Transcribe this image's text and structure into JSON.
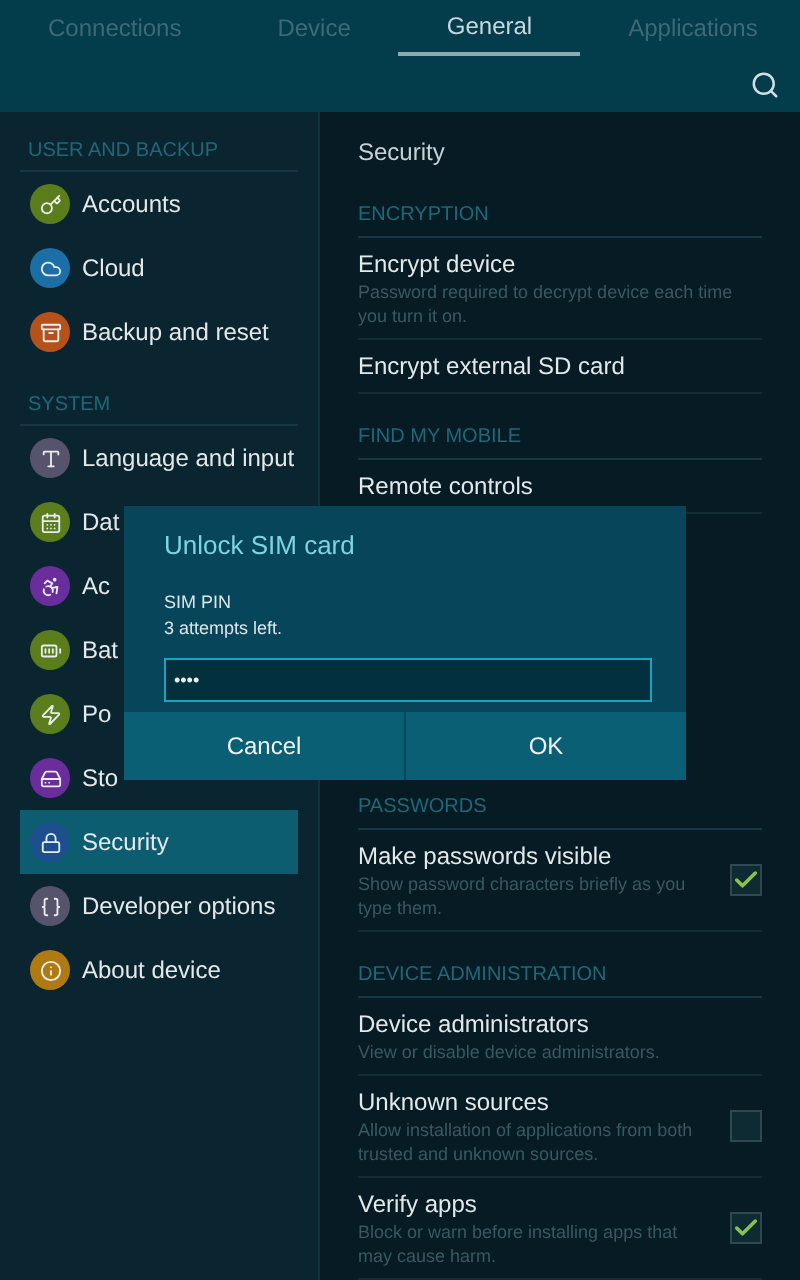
{
  "tabs": [
    {
      "label": "Connections",
      "selected": false
    },
    {
      "label": "Device",
      "selected": false
    },
    {
      "label": "General",
      "selected": true
    },
    {
      "label": "Applications",
      "selected": false
    }
  ],
  "sidebar": {
    "sections": [
      {
        "header": "USER AND BACKUP",
        "items": [
          {
            "label": "Accounts",
            "color": "#5b7d1c",
            "selected": false
          },
          {
            "label": "Cloud",
            "color": "#1c6ea6",
            "selected": false
          },
          {
            "label": "Backup and reset",
            "color": "#b5521c",
            "selected": false
          }
        ]
      },
      {
        "header": "SYSTEM",
        "items": [
          {
            "label": "Language and input",
            "color": "#57536d",
            "selected": false
          },
          {
            "label": "Dat",
            "color": "#5b7d1c",
            "selected": false
          },
          {
            "label": "Ac",
            "color": "#6a2d9c",
            "selected": false
          },
          {
            "label": "Bat",
            "color": "#5b7d1c",
            "selected": false
          },
          {
            "label": "Po",
            "color": "#5b7d1c",
            "selected": false
          },
          {
            "label": "Sto",
            "color": "#6a2d9c",
            "selected": false
          },
          {
            "label": "Security",
            "color": "#1d4f8c",
            "selected": true
          },
          {
            "label": "Developer options",
            "color": "#57536d",
            "selected": false
          },
          {
            "label": "About device",
            "color": "#b07a12",
            "selected": false
          }
        ]
      }
    ]
  },
  "content": {
    "title": "Security",
    "rows": [
      {
        "kind": "header",
        "label": "ENCRYPTION"
      },
      {
        "kind": "item",
        "title": "Encrypt device",
        "summary": "Password required to decrypt device each time you turn it on."
      },
      {
        "kind": "item",
        "title": "Encrypt external SD card"
      },
      {
        "kind": "header",
        "label": "FIND MY MOBILE"
      },
      {
        "kind": "item",
        "title": "Remote controls"
      },
      {
        "kind": "hidden"
      },
      {
        "kind": "header",
        "label": "PASSWORDS"
      },
      {
        "kind": "item",
        "title": "Make passwords visible",
        "summary": "Show password characters briefly as you type them.",
        "checked": true
      },
      {
        "kind": "header",
        "label": "DEVICE ADMINISTRATION"
      },
      {
        "kind": "item",
        "title": "Device administrators",
        "summary": "View or disable device administrators."
      },
      {
        "kind": "item",
        "title": "Unknown sources",
        "summary": "Allow installation of applications from both trusted and unknown sources.",
        "checked": false
      },
      {
        "kind": "item",
        "title": "Verify apps",
        "summary": "Block or warn before installing apps that may cause harm.",
        "checked": true
      }
    ]
  },
  "dialog": {
    "title": "Unlock SIM card",
    "label": "SIM PIN",
    "note": "3 attempts left.",
    "value": "••••",
    "buttons": [
      "Cancel",
      "OK"
    ]
  }
}
